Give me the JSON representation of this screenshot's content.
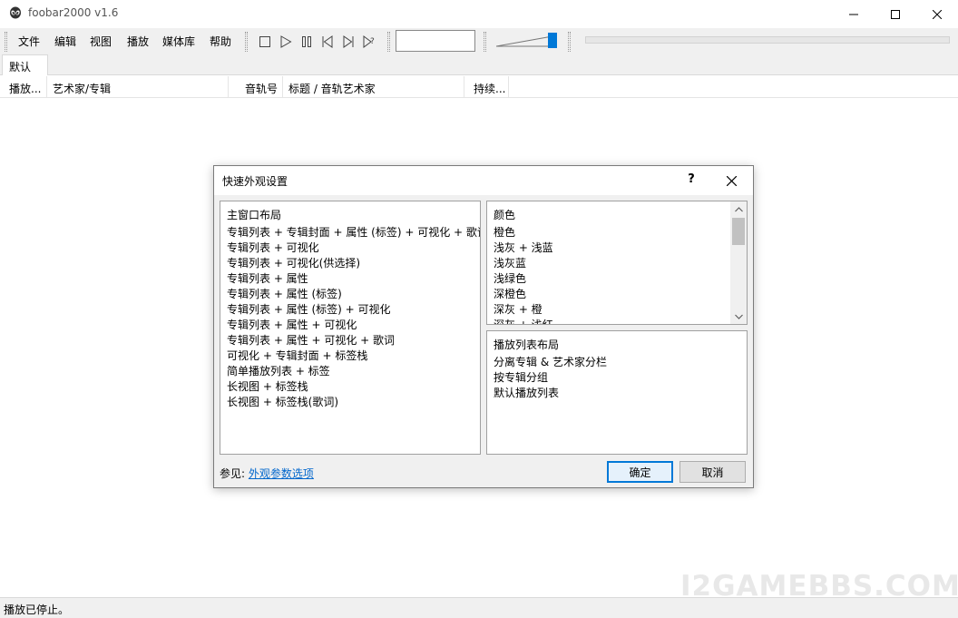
{
  "window": {
    "title": "foobar2000 v1.6"
  },
  "menu": {
    "items": [
      "文件",
      "编辑",
      "视图",
      "播放",
      "媒体库",
      "帮助"
    ]
  },
  "tabs": [
    {
      "label": "默认"
    }
  ],
  "columns": [
    {
      "label": "播放..."
    },
    {
      "label": "艺术家/专辑"
    },
    {
      "label": "音轨号"
    },
    {
      "label": "标题 / 音轨艺术家"
    },
    {
      "label": "持续..."
    }
  ],
  "volume_level": 0.95,
  "status": {
    "text": "播放已停止。"
  },
  "watermark": "I2GAMEBBS.COM",
  "dialog": {
    "title": "快速外观设置",
    "help": "?",
    "layout_list": {
      "header": "主窗口布局",
      "items": [
        "专辑列表 + 专辑封面 + 属性 (标签) + 可视化 + 歌词",
        "专辑列表 + 可视化",
        "专辑列表 + 可视化(供选择)",
        "专辑列表 + 属性",
        "专辑列表 + 属性 (标签)",
        "专辑列表 + 属性 (标签) + 可视化",
        "专辑列表 + 属性 + 可视化",
        "专辑列表 + 属性 + 可视化 + 歌词",
        "可视化 + 专辑封面 + 标签栈",
        "简单播放列表 + 标签",
        "长视图 + 标签栈",
        "长视图 + 标签栈(歌词)"
      ]
    },
    "colors_list": {
      "header": "颜色",
      "items": [
        "橙色",
        "浅灰 + 浅蓝",
        "浅灰蓝",
        "浅绿色",
        "深橙色",
        "深灰 + 橙",
        "深灰 + 浅红"
      ]
    },
    "playlist_list": {
      "header": "播放列表布局",
      "items": [
        "分离专辑 & 艺术家分栏",
        "按专辑分组",
        "默认播放列表"
      ]
    },
    "seealso_prefix": "参见:",
    "seealso_link": "外观参数选项",
    "ok_label": "确定",
    "cancel_label": "取消"
  }
}
